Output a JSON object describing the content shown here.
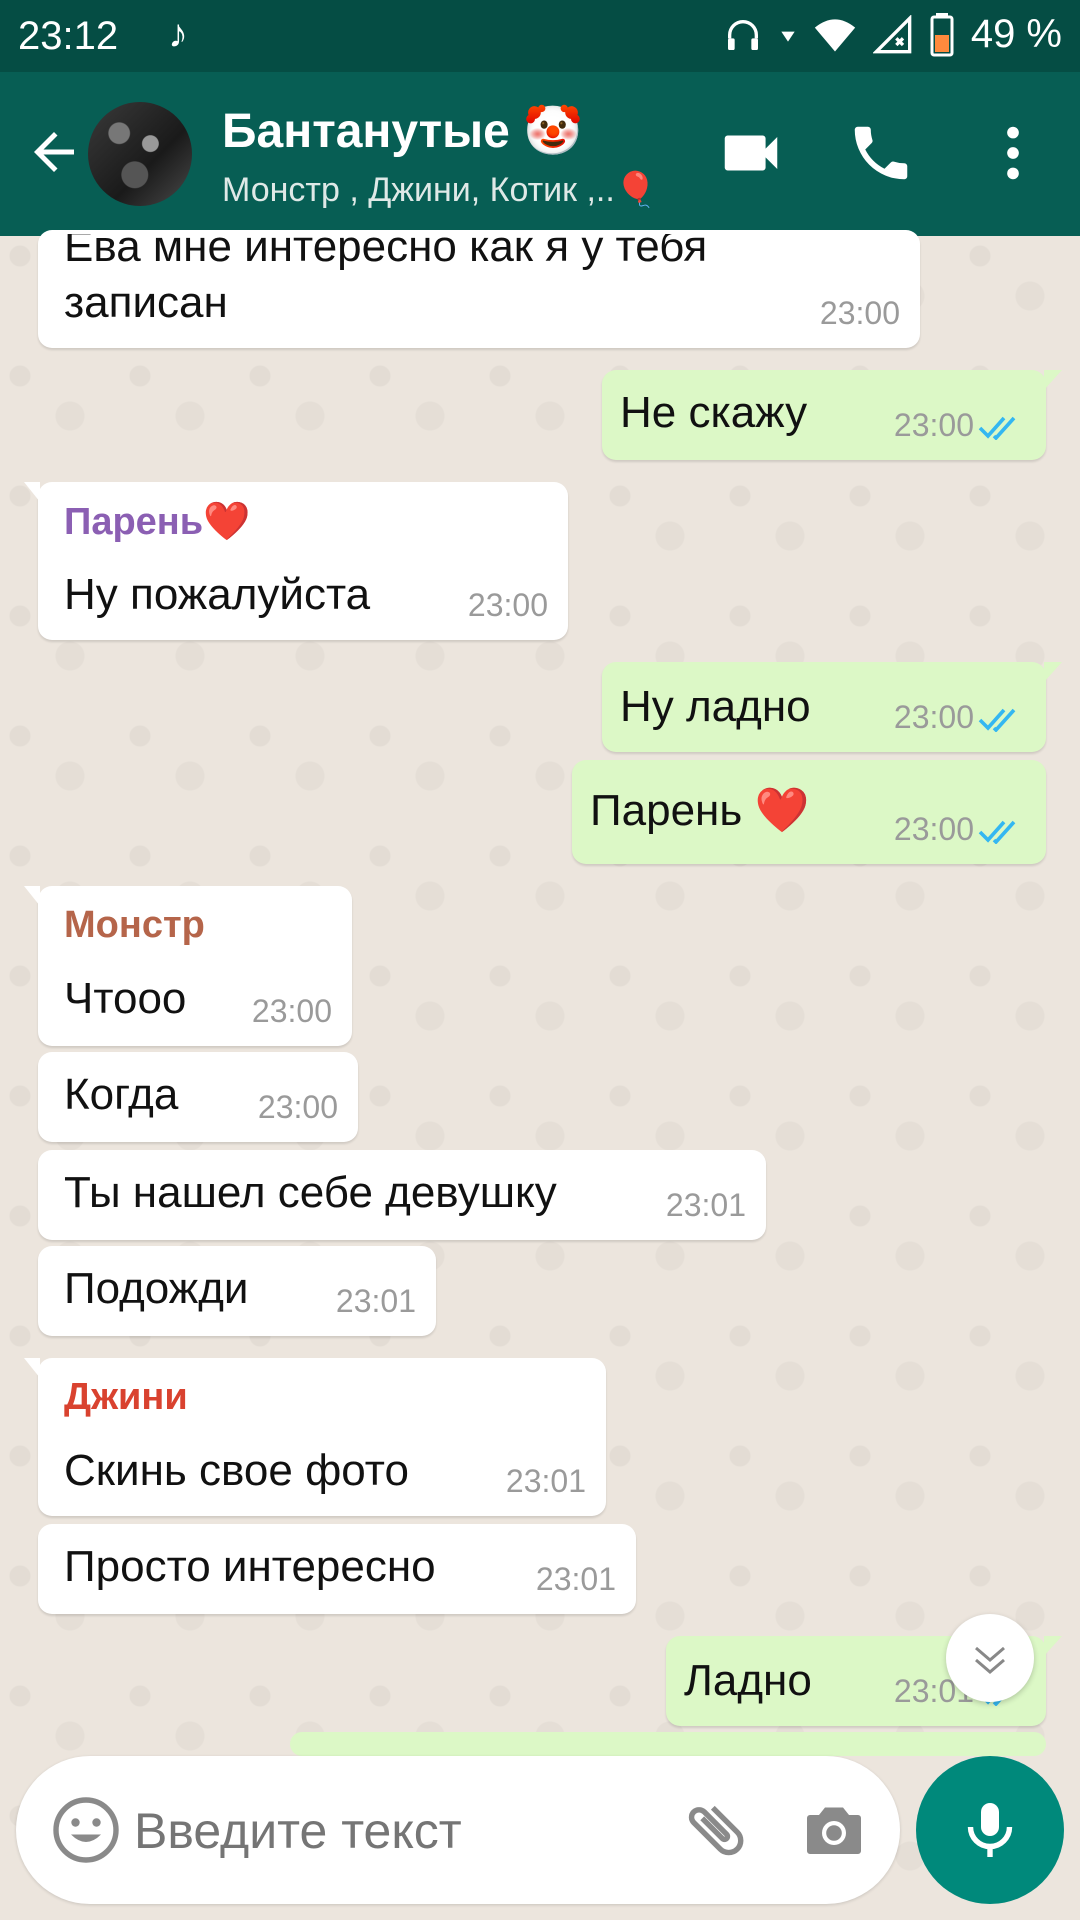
{
  "status": {
    "time": "23:12",
    "music_icon": "music-note-icon",
    "battery": "49 %"
  },
  "header": {
    "title": "Бантанутые 🤡",
    "subtitle": "Монстр , Джини, Котик ,..🎈"
  },
  "colors": {
    "header_bg": "#075e54",
    "status_bg": "#054d44",
    "incoming_bubble": "#ffffff",
    "outgoing_bubble": "#dcf8c6",
    "read_ticks": "#34b7f1",
    "sender_parent": "#8b5fb3",
    "sender_monster": "#b5654a",
    "sender_jini": "#d9422f"
  },
  "messages": [
    {
      "text": "Ева мне интересно как я у тебя",
      "text2": "записан",
      "time": "23:00"
    },
    {
      "text": "Не скажу",
      "time": "23:00"
    },
    {
      "sender": "Парень❤️",
      "text": "Ну пожалуйста",
      "time": "23:00"
    },
    {
      "text": "Ну ладно",
      "time": "23:00"
    },
    {
      "text": "Парень ❤️",
      "time": "23:00"
    },
    {
      "sender": "Монстр",
      "text": "Чтооо",
      "time": "23:00"
    },
    {
      "text": "Когда",
      "time": "23:00"
    },
    {
      "text": "Ты нашел себе девушку",
      "time": "23:01"
    },
    {
      "text": "Подожди",
      "time": "23:01"
    },
    {
      "sender": "Джини",
      "text": "Скинь свое фото",
      "time": "23:01"
    },
    {
      "text": "Просто интересно",
      "time": "23:01"
    },
    {
      "text": "Ладно",
      "time": "23:01"
    }
  ],
  "composer": {
    "placeholder": "Введите текст"
  }
}
